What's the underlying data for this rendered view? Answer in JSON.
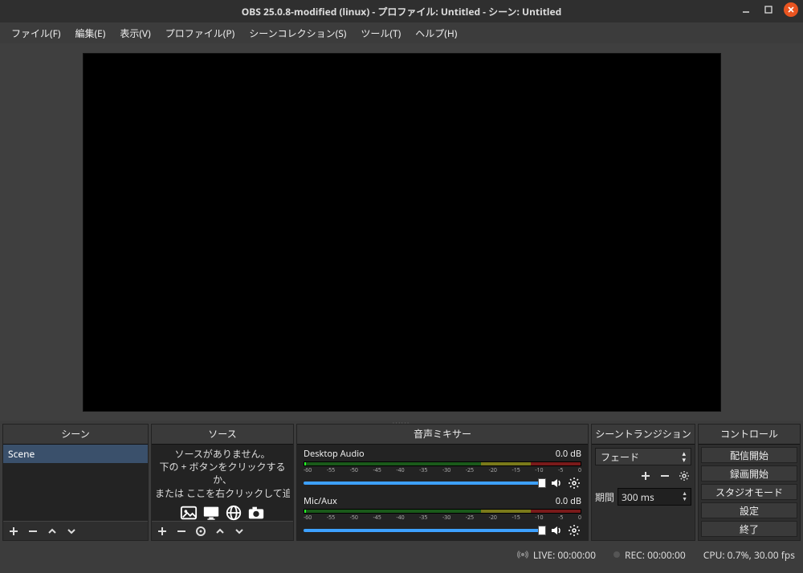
{
  "titlebar": {
    "title": "OBS 25.0.8-modified (linux) - プロファイル: Untitled - シーン: Untitled"
  },
  "menu": {
    "file": "ファイル(F)",
    "edit": "編集(E)",
    "view": "表示(V)",
    "profile": "プロファイル(P)",
    "scene_collection": "シーンコレクション(S)",
    "tools": "ツール(T)",
    "help": "ヘルプ(H)"
  },
  "panels": {
    "scenes": {
      "title": "シーン",
      "items": [
        "Scene"
      ]
    },
    "sources": {
      "title": "ソース",
      "empty_lines": [
        "ソースがありません。",
        "下の + ボタンをクリックするか、",
        "または ここを右クリックして追加してください。"
      ]
    },
    "mixer": {
      "title": "音声ミキサー",
      "channels": [
        {
          "name": "Desktop Audio",
          "db": "0.0 dB"
        },
        {
          "name": "Mic/Aux",
          "db": "0.0 dB"
        }
      ],
      "ticks": [
        "-60",
        "-55",
        "-50",
        "-45",
        "-40",
        "-35",
        "-30",
        "-25",
        "-20",
        "-15",
        "-10",
        "-5",
        "0"
      ]
    },
    "transitions": {
      "title": "シーントランジション",
      "selected": "フェード",
      "duration_label": "期間",
      "duration_value": "300 ms"
    },
    "controls": {
      "title": "コントロール",
      "buttons": {
        "start_stream": "配信開始",
        "start_record": "録画開始",
        "studio_mode": "スタジオモード",
        "settings": "設定",
        "exit": "終了"
      }
    }
  },
  "status": {
    "live": "LIVE: 00:00:00",
    "rec": "REC: 00:00:00",
    "cpu": "CPU: 0.7%, 30.00 fps"
  }
}
